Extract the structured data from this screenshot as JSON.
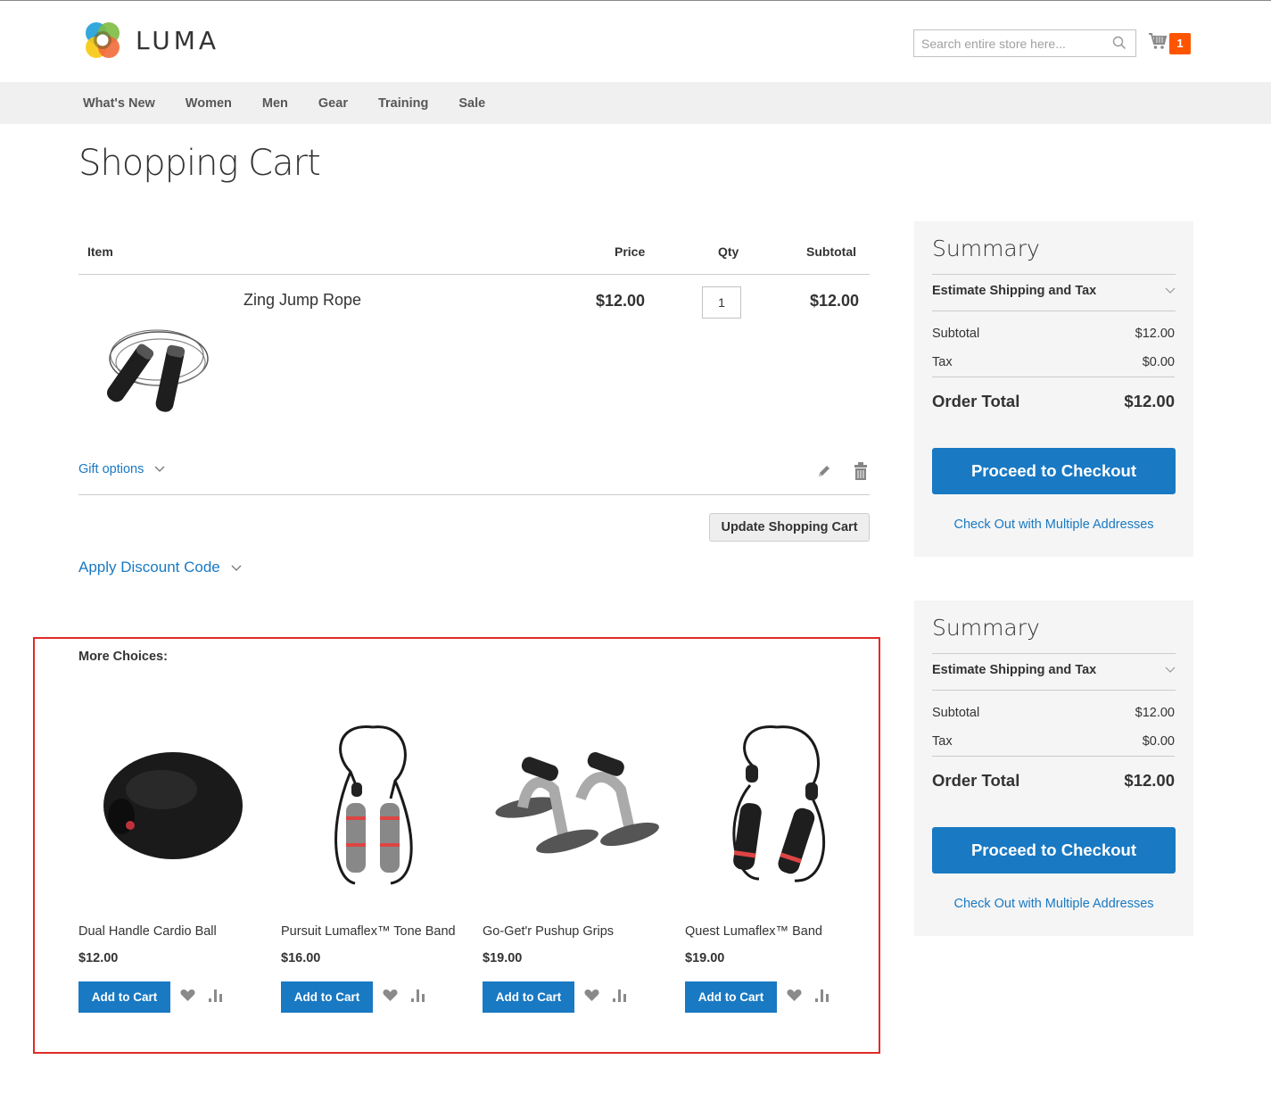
{
  "header": {
    "logo_text": "LUMA",
    "search_placeholder": "Search entire store here...",
    "cart_count": "1"
  },
  "nav": {
    "items": [
      "What's New",
      "Women",
      "Men",
      "Gear",
      "Training",
      "Sale"
    ]
  },
  "page_title": "Shopping Cart",
  "cart": {
    "columns": {
      "item": "Item",
      "price": "Price",
      "qty": "Qty",
      "subtotal": "Subtotal"
    },
    "items": [
      {
        "name": "Zing Jump Rope",
        "price": "$12.00",
        "qty": "1",
        "subtotal": "$12.00"
      }
    ],
    "gift_options": "Gift options",
    "update_button": "Update Shopping Cart",
    "discount_label": "Apply Discount Code"
  },
  "summaries": [
    {
      "title": "Summary",
      "estimate_label": "Estimate Shipping and Tax",
      "subtotal_label": "Subtotal",
      "subtotal_value": "$12.00",
      "tax_label": "Tax",
      "tax_value": "$0.00",
      "order_total_label": "Order Total",
      "order_total_value": "$12.00",
      "checkout_button": "Proceed to Checkout",
      "multi_address_link": "Check Out with Multiple Addresses"
    },
    {
      "title": "Summary",
      "estimate_label": "Estimate Shipping and Tax",
      "subtotal_label": "Subtotal",
      "subtotal_value": "$12.00",
      "tax_label": "Tax",
      "tax_value": "$0.00",
      "order_total_label": "Order Total",
      "order_total_value": "$12.00",
      "checkout_button": "Proceed to Checkout",
      "multi_address_link": "Check Out with Multiple Addresses"
    }
  ],
  "more_choices": {
    "title": "More Choices:",
    "add_to_cart_label": "Add to Cart",
    "products": [
      {
        "name": "Dual Handle Cardio Ball",
        "price": "$12.00"
      },
      {
        "name": "Pursuit Lumaflex™ Tone Band",
        "price": "$16.00"
      },
      {
        "name": "Go-Get'r Pushup Grips",
        "price": "$19.00"
      },
      {
        "name": "Quest Lumaflex™ Band",
        "price": "$19.00"
      }
    ]
  },
  "colors": {
    "primary": "#1979c3",
    "cart_badge": "#ff5501",
    "highlight_border": "#e02b27"
  }
}
